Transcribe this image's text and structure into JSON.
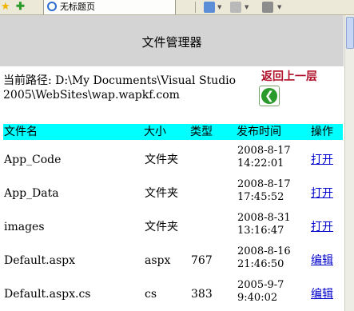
{
  "browser": {
    "tab_title": "无标题页"
  },
  "header": {
    "title": "文件管理器"
  },
  "path": {
    "label": "当前路径:",
    "value": "D:\\My Documents\\Visual Studio 2005\\WebSites\\wap.wapkf.com"
  },
  "back": {
    "label": "返回上一层"
  },
  "table": {
    "headers": [
      "文件名",
      "大小",
      "类型",
      "发布时间",
      "操作"
    ],
    "rows": [
      {
        "name": "App_Code",
        "size": "文件夹",
        "type": "",
        "date": "2008-8-17",
        "time": "14:22:01",
        "action": "打开"
      },
      {
        "name": "App_Data",
        "size": "文件夹",
        "type": "",
        "date": "2008-8-17",
        "time": "17:45:52",
        "action": "打开"
      },
      {
        "name": "images",
        "size": "文件夹",
        "type": "",
        "date": "2008-8-31",
        "time": "13:16:47",
        "action": "打开"
      },
      {
        "name": "Default.aspx",
        "size": "aspx",
        "type": "767",
        "date": "2008-8-16",
        "time": "21:46:50",
        "action": "编辑"
      },
      {
        "name": "Default.aspx.cs",
        "size": "cs",
        "type": "383",
        "date": "2005-9-7",
        "time": "9:40:02",
        "action": "编辑"
      }
    ]
  },
  "colors": {
    "header_bg": "#d4d4d4",
    "table_head_bg": "#00ffff",
    "back_link": "#b0102a",
    "link": "#0000cc"
  }
}
